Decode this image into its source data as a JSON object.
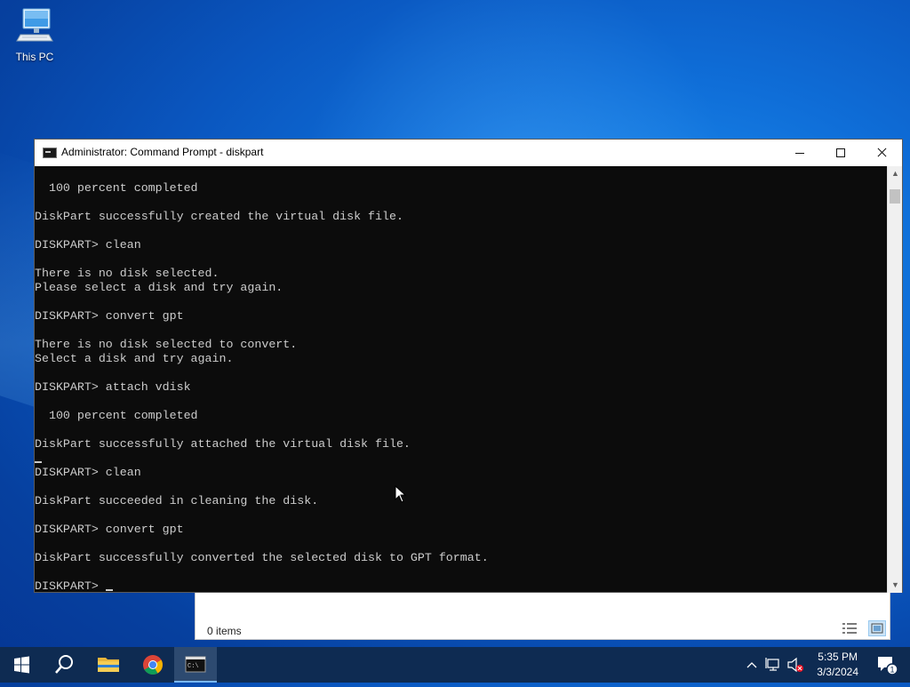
{
  "desktop": {
    "icons": [
      {
        "label": "This PC",
        "icon": "this-pc-icon"
      }
    ]
  },
  "explorer": {
    "status": "0 items"
  },
  "cmd_window": {
    "title": "Administrator: Command Prompt - diskpart",
    "lines": [
      "  100 percent completed",
      "",
      "DiskPart successfully created the virtual disk file.",
      "",
      "DISKPART> clean",
      "",
      "There is no disk selected.",
      "Please select a disk and try again.",
      "",
      "DISKPART> convert gpt",
      "",
      "There is no disk selected to convert.",
      "Select a disk and try again.",
      "",
      "DISKPART> attach vdisk",
      "",
      "  100 percent completed",
      "",
      "DiskPart successfully attached the virtual disk file.",
      "",
      "DISKPART> clean",
      "",
      "DiskPart succeeded in cleaning the disk.",
      "",
      "DISKPART> convert gpt",
      "",
      "DiskPart successfully converted the selected disk to GPT format.",
      "",
      "DISKPART> "
    ],
    "colors": {
      "background": "#0c0c0c",
      "text": "#cccccc"
    }
  },
  "taskbar": {
    "apps": [
      {
        "name": "Start",
        "icon": "windows-start-icon"
      },
      {
        "name": "Search",
        "icon": "search-icon"
      },
      {
        "name": "File Explorer",
        "icon": "folder-icon"
      },
      {
        "name": "Google Chrome",
        "icon": "chrome-icon"
      },
      {
        "name": "Command Prompt",
        "icon": "cmd-icon",
        "active": true
      }
    ],
    "tray": {
      "time": "5:35 PM",
      "date": "3/3/2024",
      "notification_count": "1"
    },
    "color": "#0e2b52"
  }
}
